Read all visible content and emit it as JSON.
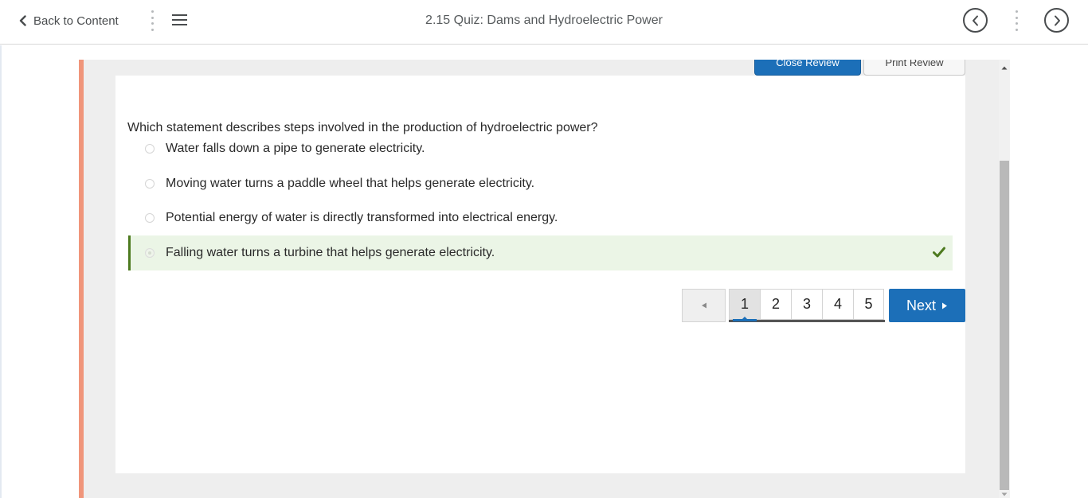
{
  "topbar": {
    "back_label": "Back to Content",
    "title": "2.15 Quiz: Dams and Hydroelectric Power"
  },
  "review": {
    "close_label": "Close Review",
    "print_label": "Print Review"
  },
  "question": {
    "text": "Which statement describes steps involved in the production of hydroelectric power?",
    "options": [
      {
        "label": "Water falls down a pipe to generate electricity.",
        "status": "unselected"
      },
      {
        "label": "Moving water turns a paddle wheel that helps generate electricity.",
        "status": "unselected"
      },
      {
        "label": "Potential energy of water is directly transformed into electrical energy.",
        "status": "unselected"
      },
      {
        "label": "Falling water turns a turbine that helps generate electricity.",
        "status": "correct-selected"
      }
    ]
  },
  "pagination": {
    "pages": [
      "1",
      "2",
      "3",
      "4",
      "5"
    ],
    "current": "1",
    "next_label": "Next"
  },
  "colors": {
    "accent": "#1c6fb8",
    "left_accent": "#f0957a",
    "correct_bg": "#ebf5e6",
    "correct_mark": "#4d7a1f"
  }
}
